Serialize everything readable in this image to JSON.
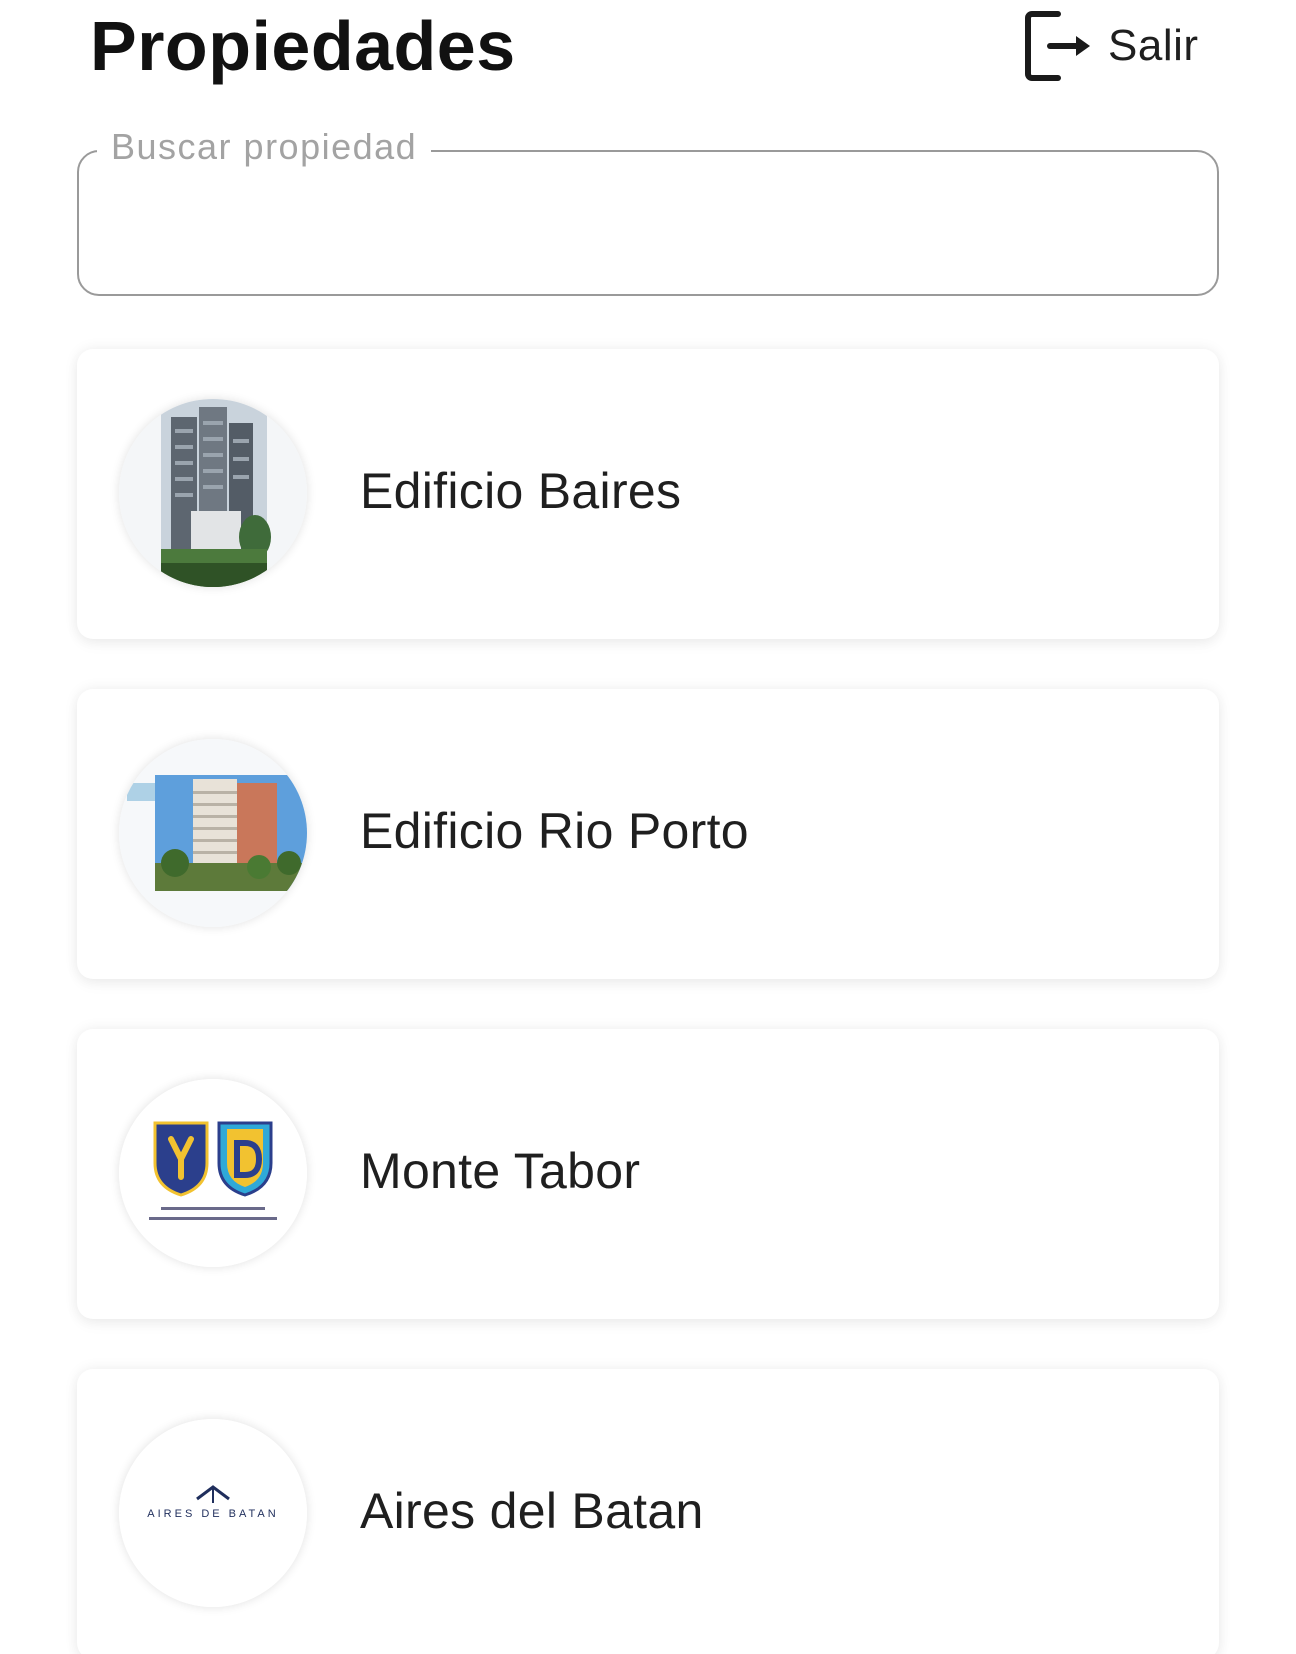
{
  "header": {
    "title": "Propiedades",
    "logout_label": "Salir",
    "logout_icon": "logout-icon"
  },
  "search": {
    "label": "Buscar propiedad",
    "value": ""
  },
  "properties": [
    {
      "name": "Edificio Baires",
      "image": "building-photo"
    },
    {
      "name": "Edificio Rio Porto",
      "image": "building-photo"
    },
    {
      "name": "Monte Tabor",
      "image": "school-crests-logo"
    },
    {
      "name": "Aires del Batan",
      "image": "aires-del-batan-logo",
      "logo_text": "AIRES DE BATAN"
    }
  ]
}
